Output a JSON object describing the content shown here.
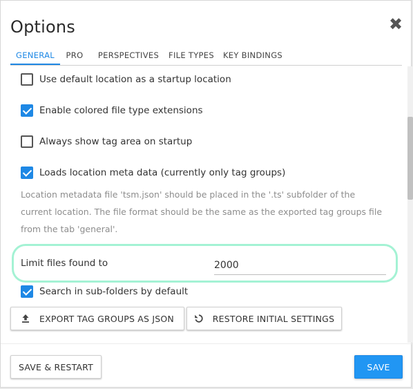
{
  "dialog": {
    "title": "Options",
    "close_glyph": "✖"
  },
  "tabs": [
    {
      "label": "GENERAL",
      "active": true
    },
    {
      "label": "PRO",
      "active": false
    },
    {
      "label": "PERSPECTIVES",
      "active": false
    },
    {
      "label": "FILE TYPES",
      "active": false
    },
    {
      "label": "KEY BINDINGS",
      "active": false
    }
  ],
  "settings": {
    "default_location": {
      "label": "Use default location as a startup location",
      "checked": false
    },
    "colored_extensions": {
      "label": "Enable colored file type extensions",
      "checked": true
    },
    "tag_area": {
      "label": "Always show tag area on startup",
      "checked": false
    },
    "location_meta": {
      "label": "Loads location meta data (currently only tag groups)",
      "checked": true
    },
    "location_meta_note_1": "Location metadata file 'tsm.json' should be placed in the '.ts' subfolder of the",
    "location_meta_note_2": "current location. The file format should be the same as the exported tag groups file",
    "location_meta_note_3": "from the tab 'general'.",
    "limit_files": {
      "label": "Limit files found to",
      "value": "2000"
    },
    "subfolders": {
      "label": "Search in sub-folders by default",
      "checked": true
    }
  },
  "actions": {
    "export_label": "EXPORT TAG GROUPS AS JSON",
    "export_icon": "upload-icon",
    "restore_label": "RESTORE INITIAL SETTINGS",
    "restore_icon": "restore-icon"
  },
  "footer": {
    "save_restart_label": "SAVE & RESTART",
    "save_label": "SAVE"
  },
  "colors": {
    "accent": "#1e88e5",
    "highlight": "#a4f2d4"
  }
}
